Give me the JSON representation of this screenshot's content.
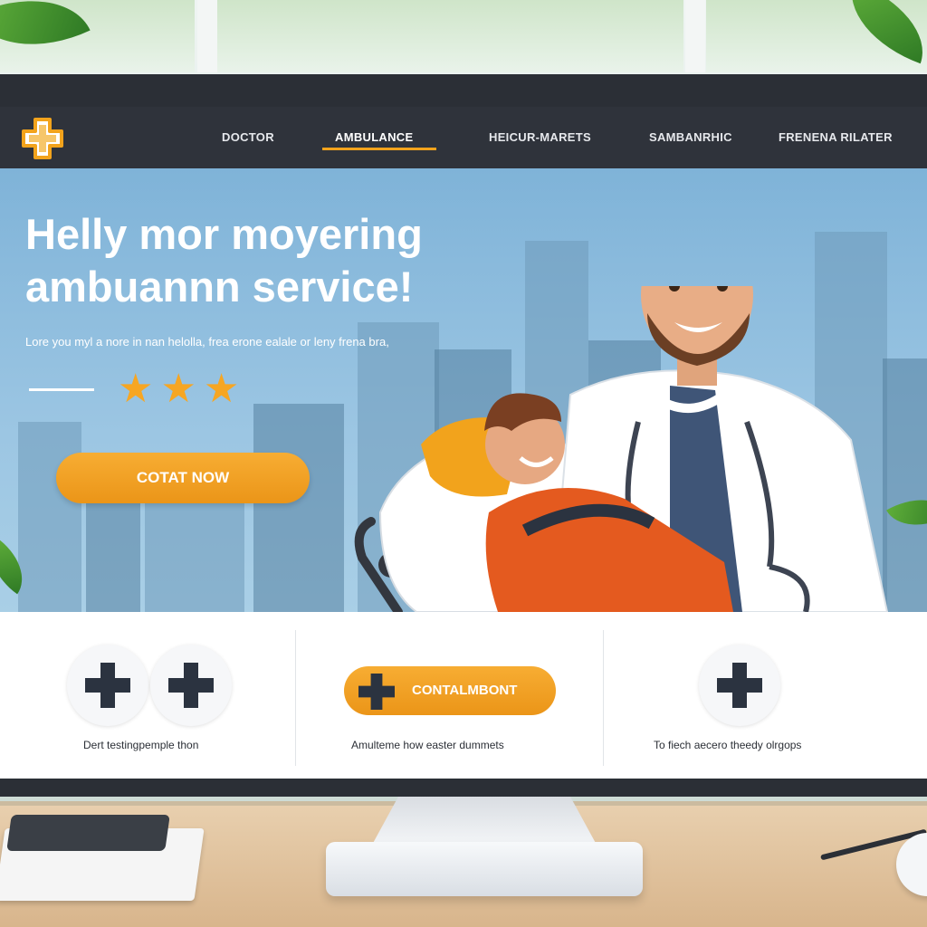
{
  "nav": {
    "items": [
      {
        "label": "DOCTOR"
      },
      {
        "label": "AMBULANCE"
      },
      {
        "label": "HEICUR-MARETS"
      },
      {
        "label": "SAMBANRHIC"
      },
      {
        "label": "FRENENA RILATER"
      }
    ],
    "active_index": 1
  },
  "hero": {
    "title_line1": "Helly mor moyering",
    "title_line2": "ambuannn service!",
    "subtitle": "Lore you myl a nore in nan helolla, frea erone ealale or leny frena bra,",
    "rating": 3,
    "cta_label": "COTAT NOW"
  },
  "features": {
    "left_caption": "Dert testingpemple thon",
    "middle_button_label": "CONTALMBONT",
    "middle_caption": "Amulteme how easter dummets",
    "right_caption": "To fiech aecero theedy olrgops"
  },
  "colors": {
    "accent": "#f2a31c",
    "nav_bg": "#2f333b",
    "hero_bg": "#8fbde0",
    "icon_dark": "#2b3340"
  },
  "icons": {
    "logo": "medical-cross-icon",
    "feature": "plus-cross-icon",
    "star": "star-icon"
  }
}
